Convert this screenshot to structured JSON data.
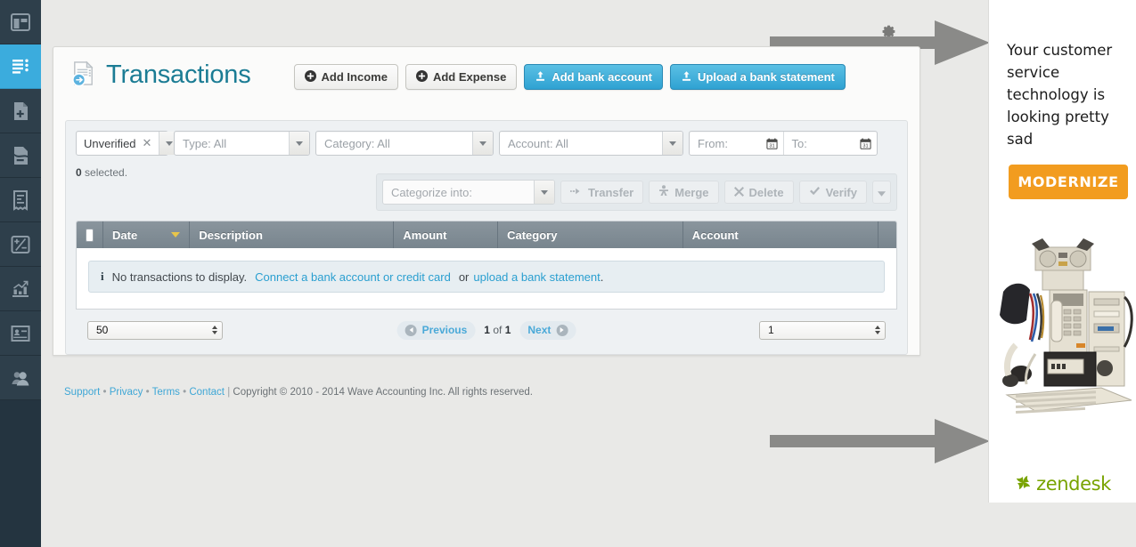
{
  "sidebar": {
    "items": [
      {
        "name": "dashboard",
        "icon": "layout-icon",
        "active": false
      },
      {
        "name": "transactions",
        "icon": "list-lines-icon",
        "active": true
      },
      {
        "name": "income",
        "icon": "document-plus-icon",
        "active": false
      },
      {
        "name": "expense",
        "icon": "document-minus-icon",
        "active": false
      },
      {
        "name": "receipts",
        "icon": "receipt-icon",
        "active": false
      },
      {
        "name": "journal",
        "icon": "plus-minus-icon",
        "active": false
      },
      {
        "name": "reports",
        "icon": "bar-chart-icon",
        "active": false
      },
      {
        "name": "invoices",
        "icon": "id-card-icon",
        "active": false
      },
      {
        "name": "customers",
        "icon": "people-icon",
        "active": false
      }
    ]
  },
  "header": {
    "title": "Transactions",
    "title_icon": "document-arrow-icon",
    "settings_icon": "gear-icon",
    "buttons": [
      {
        "label": "Add Income",
        "icon": "plus-circle-icon",
        "style": "grey"
      },
      {
        "label": "Add Expense",
        "icon": "plus-circle-icon",
        "style": "grey"
      },
      {
        "label": "Add bank account",
        "icon": "upload-icon",
        "style": "blue"
      },
      {
        "label": "Upload a bank statement",
        "icon": "upload-icon",
        "style": "blue"
      }
    ]
  },
  "filters": {
    "status_tag": "Unverified",
    "status_remove_icon": "close-x-icon",
    "type": "Type: All",
    "category": "Category: All",
    "account": "Account: All",
    "date_from_label": "From:",
    "date_to_label": "To:",
    "calendar_icon": "calendar-icon",
    "calendar_day": "31"
  },
  "toolbar": {
    "selected_count": "0",
    "selected_text": "selected.",
    "categorize_placeholder": "Categorize into:",
    "actions": [
      {
        "label": "Transfer",
        "icon": "transfer-arrow-icon",
        "disabled": true
      },
      {
        "label": "Merge",
        "icon": "merge-icon",
        "disabled": true
      },
      {
        "label": "Delete",
        "icon": "close-x-icon",
        "disabled": true
      },
      {
        "label": "Verify",
        "icon": "checkmark-icon",
        "disabled": true
      }
    ]
  },
  "table": {
    "select_all_checkbox": "select-all-checkbox",
    "columns": [
      {
        "label": "Date",
        "sorted": true,
        "sort_dir": "desc"
      },
      {
        "label": "Description",
        "sorted": false
      },
      {
        "label": "Amount",
        "sorted": false
      },
      {
        "label": "Category",
        "sorted": false
      },
      {
        "label": "Account",
        "sorted": false
      }
    ],
    "empty_state": {
      "icon": "info-icon",
      "text_before": "No transactions to display.",
      "link1": "Connect a bank account or credit card",
      "text_mid": "or",
      "link2": "upload a bank statement",
      "text_after": "."
    }
  },
  "pagination": {
    "per_page": "50",
    "previous_label": "Previous",
    "next_label": "Next",
    "page_current": "1",
    "page_of": "of",
    "page_total": "1",
    "page_input": "1"
  },
  "footer": {
    "links": [
      "Support",
      "Privacy",
      "Terms",
      "Contact"
    ],
    "separator": "•",
    "divider": "|",
    "copyright": "Copyright © 2010 - 2014 Wave Accounting Inc. All rights reserved."
  },
  "ad": {
    "headline": "Your customer service technology is looking pretty sad",
    "cta_label": "MODERNIZE",
    "image_alt": "old-computer-equipment-photo",
    "brand": "zendesk",
    "brand_color": "#78a300",
    "cta_color": "#f29c1f"
  },
  "annotations": {
    "arrow_top": "right-arrow-annotation",
    "arrow_bottom": "right-arrow-annotation"
  },
  "colors": {
    "accent": "#1b7c94",
    "primary_button": "#2fa2d2",
    "link": "#3fa7d6",
    "sidebar_active": "#3bacdd",
    "sort_arrow": "#e8c54a"
  }
}
